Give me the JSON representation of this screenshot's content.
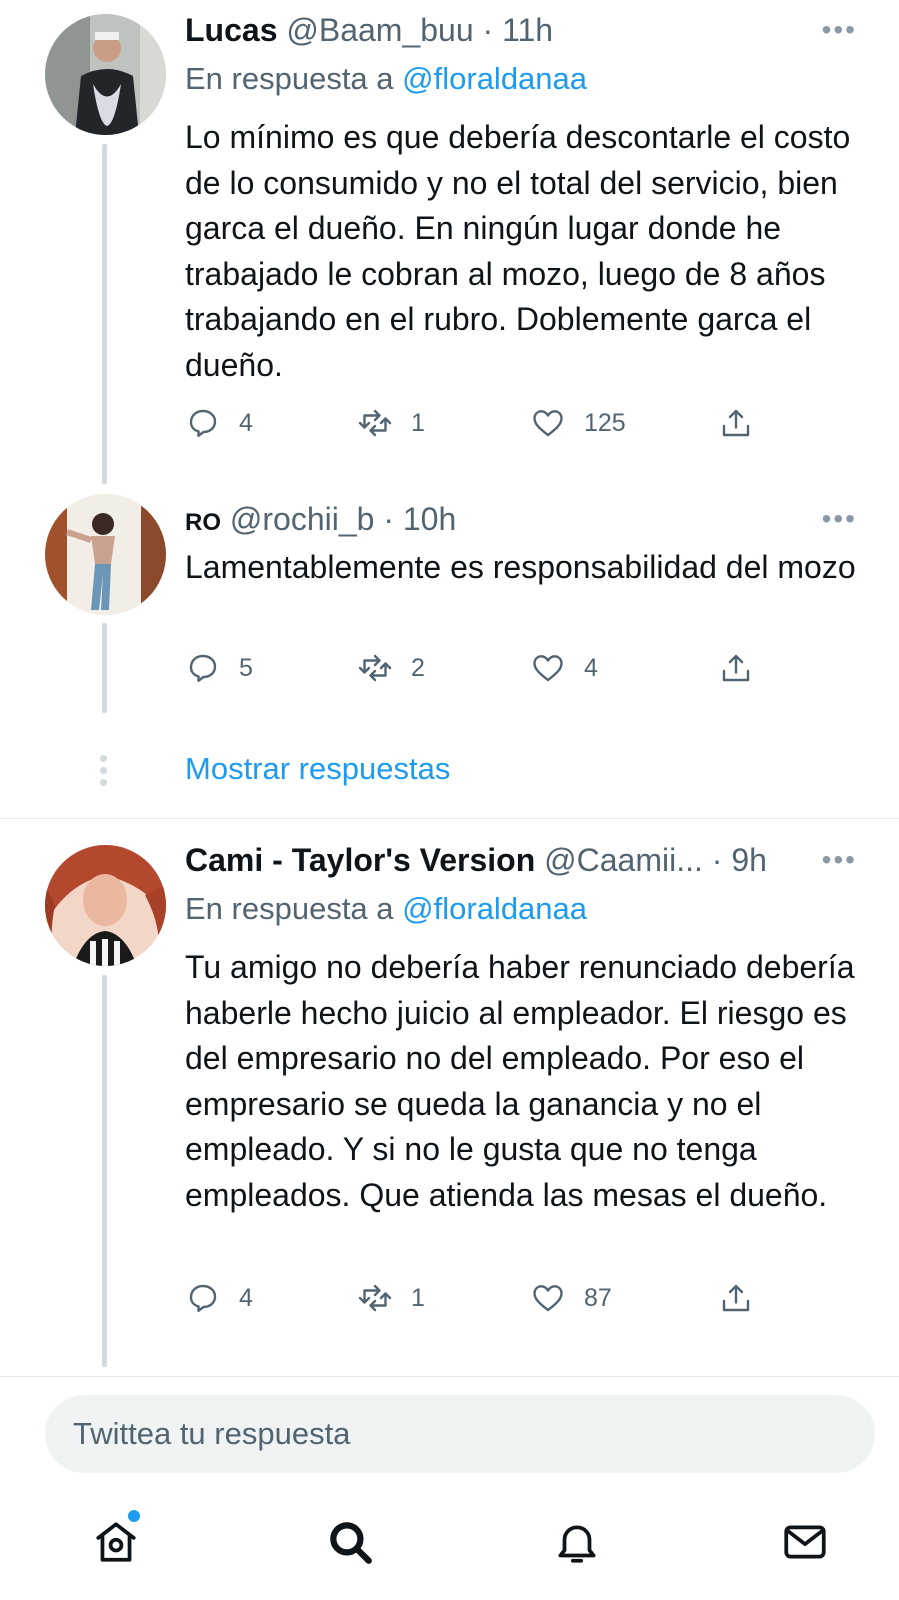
{
  "colors": {
    "accent": "#1d9bf0",
    "muted": "#536471",
    "text": "#0f1419"
  },
  "tweets": [
    {
      "name": "Lucas",
      "handle": "@Baam_buu",
      "time": "· 11h",
      "reply_prefix": "En respuesta a",
      "reply_to": "@floraldanaa",
      "text": "Lo mínimo es que debería descontarle el costo de lo consumido y no el total del servicio, bien garca el dueño. En ningún lugar donde he trabajado le cobran al mozo, luego de 8 años trabajando en el rubro. Doblemente garca el dueño.",
      "replies": "4",
      "retweets": "1",
      "likes": "125"
    },
    {
      "name": "RO",
      "handle": "@rochii_b",
      "time": "· 10h",
      "text": "Lamentablemente es responsabilidad del mozo",
      "replies": "5",
      "retweets": "2",
      "likes": "4"
    },
    {
      "name": "Cami - Taylor's Version",
      "handle": "@Caamii...",
      "time": "· 9h",
      "reply_prefix": "En respuesta a",
      "reply_to": "@floraldanaa",
      "text": "Tu amigo no debería haber renunciado debería haberle hecho juicio al empleador. El riesgo es del empresario no del empleado. Por eso el empresario se queda la ganancia y no el empleado. Y si no le gusta que no tenga empleados. Que atienda las mesas el dueño.",
      "replies": "4",
      "retweets": "1",
      "likes": "87"
    }
  ],
  "show_replies": "Mostrar respuestas",
  "composer": {
    "placeholder": "Twittea tu respuesta"
  },
  "more_glyph": "•••",
  "tabbar": {
    "icons": [
      "home-icon",
      "search-icon",
      "bell-icon",
      "mail-icon"
    ]
  }
}
